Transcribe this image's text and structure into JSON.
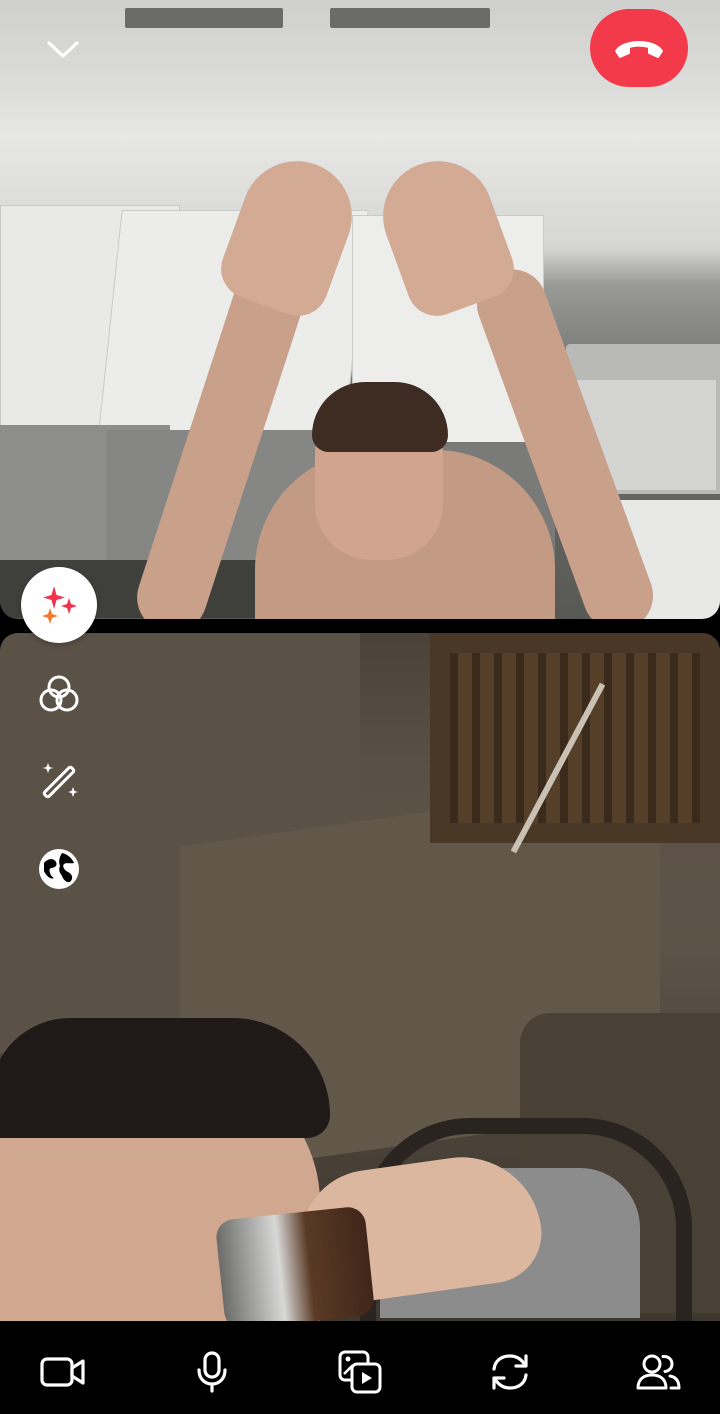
{
  "call": {
    "remote_video": {
      "description_name": "remote-participant-video"
    },
    "local_video": {
      "description_name": "self-view-video"
    }
  },
  "top_controls": {
    "collapse_icon": "chevron-down-icon",
    "end_call_icon": "phone-hangup-icon",
    "end_call_color": "#f23a4a"
  },
  "side_tools": [
    {
      "icon": "sparkles-effects-icon",
      "active": true
    },
    {
      "icon": "filters-circles-icon",
      "active": false
    },
    {
      "icon": "magic-wand-icon",
      "active": false
    },
    {
      "icon": "globe-icon",
      "active": false
    }
  ],
  "bottom_bar": [
    {
      "icon": "video-camera-icon"
    },
    {
      "icon": "microphone-icon"
    },
    {
      "icon": "media-share-icon"
    },
    {
      "icon": "flip-camera-icon"
    },
    {
      "icon": "participants-icon"
    }
  ],
  "colors": {
    "sparkle_red": "#f0324a",
    "sparkle_orange": "#f77a2a",
    "icon_white": "#ffffff"
  }
}
